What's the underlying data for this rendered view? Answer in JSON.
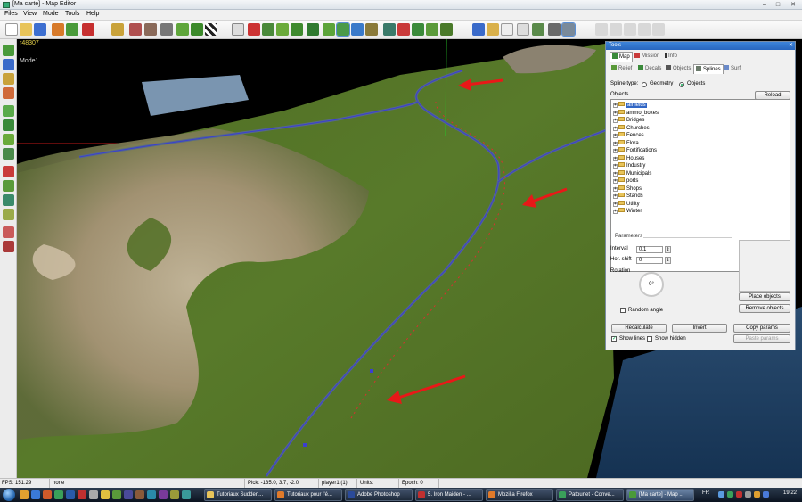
{
  "window": {
    "title": "[Ma carte] - Map Editor"
  },
  "menu": [
    "Files",
    "View",
    "Mode",
    "Tools",
    "Help"
  ],
  "viewport": {
    "coords": "r48307",
    "mode_label": "Mode1"
  },
  "tools_panel": {
    "title": "Tools",
    "main_tabs": [
      "Map",
      "Mission",
      "Info"
    ],
    "sub_tabs": [
      "Relief",
      "Decals",
      "Objects",
      "Splines",
      "Surf"
    ],
    "active_sub_tab": "Splines",
    "spline_type_label": "Spline type:",
    "spline_types": [
      "Geometry",
      "Objects"
    ],
    "spline_type_selected": "Objects",
    "objects_label": "Objects",
    "reload_label": "Reload",
    "objects": [
      "airfields",
      "ammo_boxes",
      "Bridges",
      "Churches",
      "Fences",
      "Flora",
      "Fortifications",
      "Houses",
      "Industry",
      "Municipals",
      "ports",
      "Shops",
      "Stands",
      "Utility",
      "Winter"
    ],
    "selected_object": "airfields",
    "parameters_label": "Parameters",
    "interval_label": "Interval",
    "interval_value": "0.1",
    "hor_shift_label": "Hor. shift",
    "hor_shift_value": "0",
    "rotation_label": "Rotation",
    "rotation_value": "0°",
    "random_angle_label": "Random angle",
    "place_objects_label": "Place objects",
    "remove_objects_label": "Remove objects",
    "recalculate_label": "Recalculate",
    "invert_label": "Invert",
    "copy_params_label": "Copy params",
    "paste_params_label": "Paste params",
    "show_lines_label": "Show lines",
    "show_hidden_label": "Show hidden"
  },
  "statusbar": {
    "fps": "FPS: 151.29",
    "none": "none",
    "pick": "Pick: -135.0, 3.7, -2.0",
    "player": "player1 (1)",
    "units": "Units:",
    "epoch": "Epoch: 0"
  },
  "taskbar": {
    "tasks": [
      "Tutoriaux Sudden...",
      "Tutoriaux pour l'é...",
      "Adobe Photoshop",
      "5. Iron Maiden - ...",
      "Mozilla Firefox",
      "Patounet - Conve...",
      "[Ma carte] - Map ..."
    ],
    "language": "FR",
    "clock": "19:22"
  },
  "colors": {
    "accent": "#2866bf",
    "arrow": "#e81818",
    "spline": "#3b3fd0"
  }
}
